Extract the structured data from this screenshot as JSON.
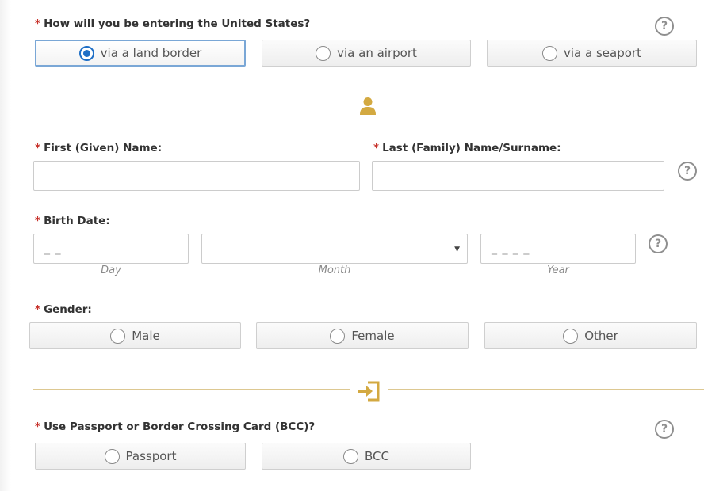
{
  "entry": {
    "label": "How will you be entering the United States?",
    "required_mark": "*",
    "options": [
      {
        "label": "via a land border",
        "selected": true
      },
      {
        "label": "via an airport",
        "selected": false
      },
      {
        "label": "via a seaport",
        "selected": false
      }
    ]
  },
  "help_icon_glyph": "?",
  "section_icons": [
    "person-icon",
    "sign-in-icon"
  ],
  "accent_color": "#d3a941",
  "required_color": "#c7322b",
  "name": {
    "first_label": "First (Given) Name:",
    "last_label": "Last (Family) Name/Surname:",
    "first_value": "",
    "last_value": ""
  },
  "birth": {
    "label": "Birth Date:",
    "day_placeholder": "_ _",
    "month_value": "",
    "year_placeholder": "_ _ _ _",
    "day_caption": "Day",
    "month_caption": "Month",
    "year_caption": "Year"
  },
  "gender": {
    "label": "Gender:",
    "options": [
      {
        "label": "Male",
        "selected": false
      },
      {
        "label": "Female",
        "selected": false
      },
      {
        "label": "Other",
        "selected": false
      }
    ]
  },
  "document": {
    "label": "Use Passport or Border Crossing Card (BCC)?",
    "options": [
      {
        "label": "Passport",
        "selected": false
      },
      {
        "label": "BCC",
        "selected": false
      }
    ]
  }
}
